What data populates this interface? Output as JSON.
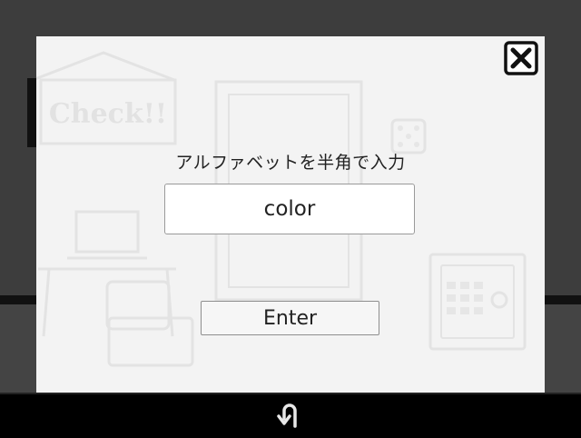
{
  "modal": {
    "prompt": "アルファベットを半角で入力",
    "input_value": "color",
    "enter_label": "Enter"
  },
  "scene": {
    "sign_text": "Check!!"
  },
  "icons": {
    "close": "close-icon",
    "back": "u-turn-back-icon"
  }
}
